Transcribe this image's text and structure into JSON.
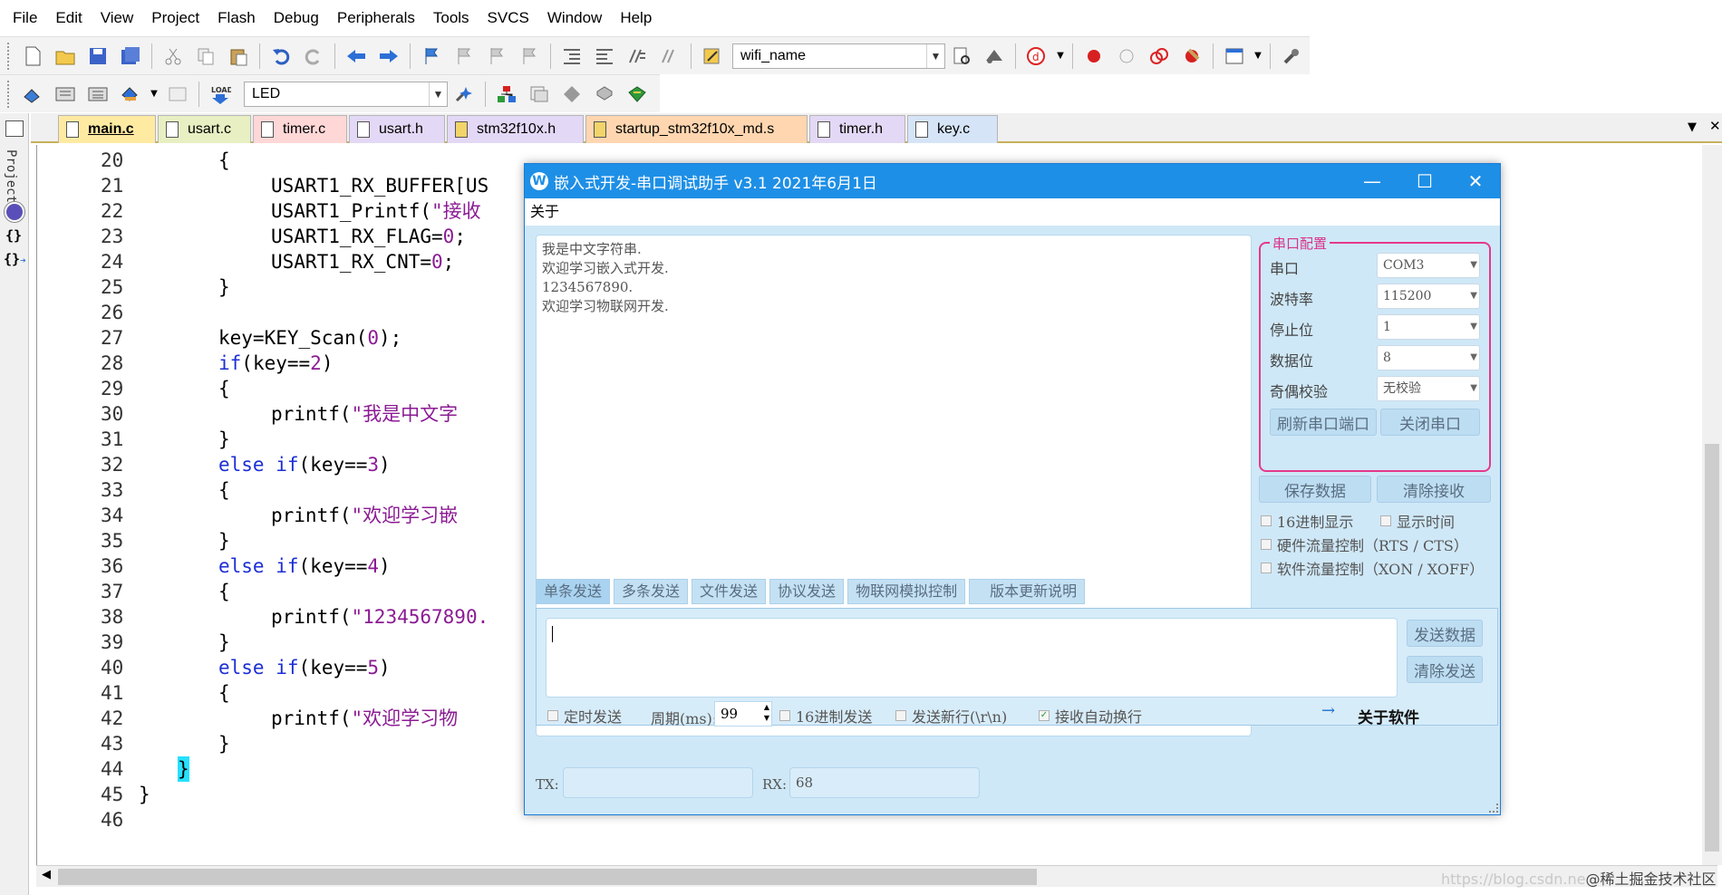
{
  "menu": [
    "File",
    "Edit",
    "View",
    "Project",
    "Flash",
    "Debug",
    "Peripherals",
    "Tools",
    "SVCS",
    "Window",
    "Help"
  ],
  "toolbar": {
    "target_combo": "wifi_name",
    "build_target": "LED"
  },
  "sidebar": {
    "project_label": "Project"
  },
  "tabs": [
    {
      "label": "main.c",
      "active": true,
      "color": "#ffeaa2"
    },
    {
      "label": "usart.c",
      "color": "#e8efc2"
    },
    {
      "label": "timer.c",
      "color": "#ffd7d7"
    },
    {
      "label": "usart.h",
      "color": "#e3d8f5"
    },
    {
      "label": "stm32f10x.h",
      "color": "#e3d8f5"
    },
    {
      "label": "startup_stm32f10x_md.s",
      "color": "#ffd6b0"
    },
    {
      "label": "timer.h",
      "color": "#e3d8f5"
    },
    {
      "label": "key.c",
      "color": "#d6e4f7"
    }
  ],
  "code": {
    "line_numbers": [
      "20",
      "21",
      "22",
      "23",
      "24",
      "25",
      "26",
      "27",
      "28",
      "29",
      "30",
      "31",
      "32",
      "33",
      "34",
      "35",
      "36",
      "37",
      "38",
      "39",
      "40",
      "41",
      "42",
      "43",
      "44",
      "45",
      "46"
    ],
    "l20": "{",
    "l21": "USART1_RX_BUFFER[US",
    "l22_fn": "USART1_Printf(",
    "l22_str": "\"接收",
    "l23_a": "USART1_RX_FLAG=",
    "l23_n": "0",
    "l23_b": ";",
    "l24_a": "USART1_RX_CNT=",
    "l24_n": "0",
    "l24_b": ";",
    "l25": "}",
    "l27_a": "key=KEY_Scan(",
    "l27_n": "0",
    "l27_b": ");",
    "kw_if": "if",
    "kw_else": "else",
    "l28_a": "(key==",
    "l28_n": "2",
    "l28_b": ")",
    "brace_open": "{",
    "brace_close": "}",
    "printf": "printf(",
    "l30_str": "\"我是中文字",
    "l32_n": "3",
    "l34_str": "\"欢迎学习嵌",
    "l36_n": "4",
    "l38_str": "\"1234567890.",
    "l40_n": "5",
    "l42_str": "\"欢迎学习物"
  },
  "watermark": {
    "url": "https://blog.csdn.ne",
    "text": "@稀土掘金技术社区"
  },
  "serial": {
    "title": "嵌入式开发-串口调试助手 v3.1 2021年6月1日",
    "window_controls": {
      "minimize": "—",
      "maximize": "☐",
      "close": "✕"
    },
    "menu_about": "关于",
    "received_lines": [
      "我是中文字符串.",
      "欢迎学习嵌入式开发.",
      "1234567890.",
      "欢迎学习物联网开发."
    ],
    "config": {
      "group_title": "串口配置",
      "port_label": "串口",
      "port_value": "COM3",
      "baud_label": "波特率",
      "baud_value": "115200",
      "stop_label": "停止位",
      "stop_value": "1",
      "data_label": "数据位",
      "data_value": "8",
      "parity_label": "奇偶校验",
      "parity_value": "无校验",
      "refresh_button": "刷新串口端口",
      "close_button": "关闭串口"
    },
    "save_button": "保存数据",
    "clear_rx_button": "清除接收",
    "options": {
      "hex_display": "16进制显示",
      "show_time": "显示时间",
      "hw_flow": "硬件流量控制（RTS / CTS）",
      "sw_flow": "软件流量控制（XON / XOFF）"
    },
    "send_tabs": [
      "单条发送",
      "多条发送",
      "文件发送",
      "协议发送",
      "物联网模拟控制",
      "版本更新说明"
    ],
    "send_button": "发送数据",
    "clear_send_button": "清除发送",
    "timed_send": "定时发送",
    "period_label": "周期(ms):",
    "period_value": "99",
    "hex_send": "16进制发送",
    "send_newline": "发送新行(\\r\\n)",
    "auto_wrap": "接收自动换行",
    "about_arrow": "→",
    "about_software": "关于软件",
    "tx_label": "TX:",
    "tx_value": "",
    "rx_label": "RX:",
    "rx_value": "68"
  }
}
